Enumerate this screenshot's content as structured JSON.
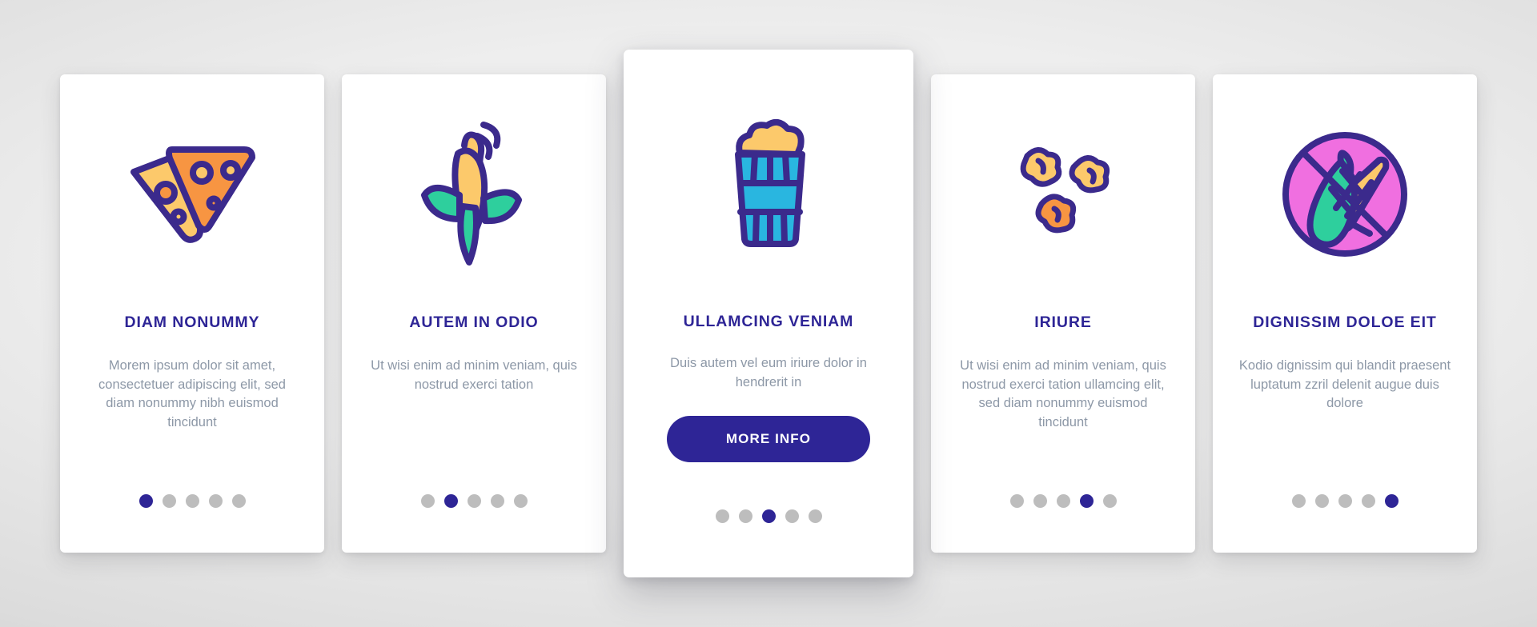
{
  "page": {
    "background_color": "#e2e2e2",
    "accent_color": "#2e2596",
    "muted_text_color": "#8d98a7",
    "dot_inactive_color": "#bdbdbd"
  },
  "cards": [
    {
      "icon": "nacho-chips-icon",
      "title": "DIAM NONUMMY",
      "body": "Morem ipsum dolor sit amet, consectetuer adipiscing elit, sed diam nonummy nibh euismod tincidunt",
      "dots": {
        "count": 5,
        "active_index": 0
      },
      "featured": false,
      "cta": null
    },
    {
      "icon": "corn-plant-icon",
      "title": "AUTEM IN ODIO",
      "body": "Ut wisi enim ad minim veniam, quis nostrud exerci tation",
      "dots": {
        "count": 5,
        "active_index": 1
      },
      "featured": false,
      "cta": null
    },
    {
      "icon": "popcorn-box-icon",
      "title": "ULLAMCING VENIAM",
      "body": "Duis autem vel eum iriure dolor in hendrerit in",
      "dots": {
        "count": 5,
        "active_index": 2
      },
      "featured": true,
      "cta": "MORE INFO"
    },
    {
      "icon": "popcorn-kernels-icon",
      "title": "IRIURE",
      "body": "Ut wisi enim ad minim veniam, quis nostrud exerci tation ullamcing elit, sed diam nonummy euismod tincidunt",
      "dots": {
        "count": 5,
        "active_index": 3
      },
      "featured": false,
      "cta": null
    },
    {
      "icon": "no-corn-icon",
      "title": "DIGNISSIM DOLOE EIT",
      "body": "Kodio dignissim qui blandit praesent luptatum zzril delenit augue duis dolore",
      "dots": {
        "count": 5,
        "active_index": 4
      },
      "featured": false,
      "cta": null
    }
  ],
  "icon_colors": {
    "outline": "#3b2a8c",
    "yellow": "#fcc96b",
    "orange": "#f79542",
    "cyan": "#29b6e0",
    "teal": "#2ecfa4",
    "green": "#2ecf9d",
    "pink": "#f06fe0",
    "pink_light": "#f49bea"
  }
}
